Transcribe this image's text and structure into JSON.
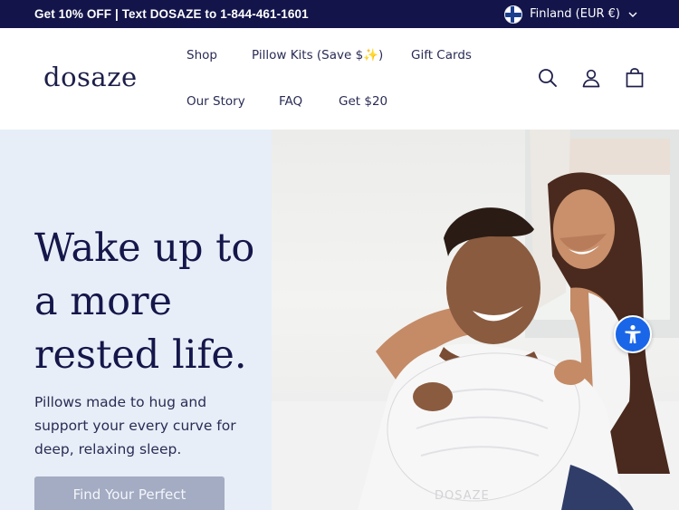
{
  "announcement": {
    "text": "Get 10% OFF | Text DOSAZE to 1-844-461-1601",
    "currency_label": "Finland (EUR €)"
  },
  "header": {
    "logo": "dosaze",
    "nav": {
      "shop": "Shop",
      "pillow_kits": "Pillow Kits (Save $✨)",
      "gift_cards": "Gift Cards",
      "our_story": "Our Story",
      "faq": "FAQ",
      "get20": "Get $20"
    },
    "icons": [
      "search-icon",
      "account-icon",
      "cart-icon"
    ]
  },
  "hero": {
    "title": "Wake up to a more rested life.",
    "subtitle": "Pillows made to hug and support your every curve for deep, relaxing sleep.",
    "cta_label": "Find Your Perfect",
    "pillow_brand": "DOSAZE"
  },
  "colors": {
    "announce_bg": "#13144a",
    "hero_left_bg": "#e7eef7",
    "cta_bg": "#a4acc3",
    "a11y_bg": "#1a66e8"
  }
}
